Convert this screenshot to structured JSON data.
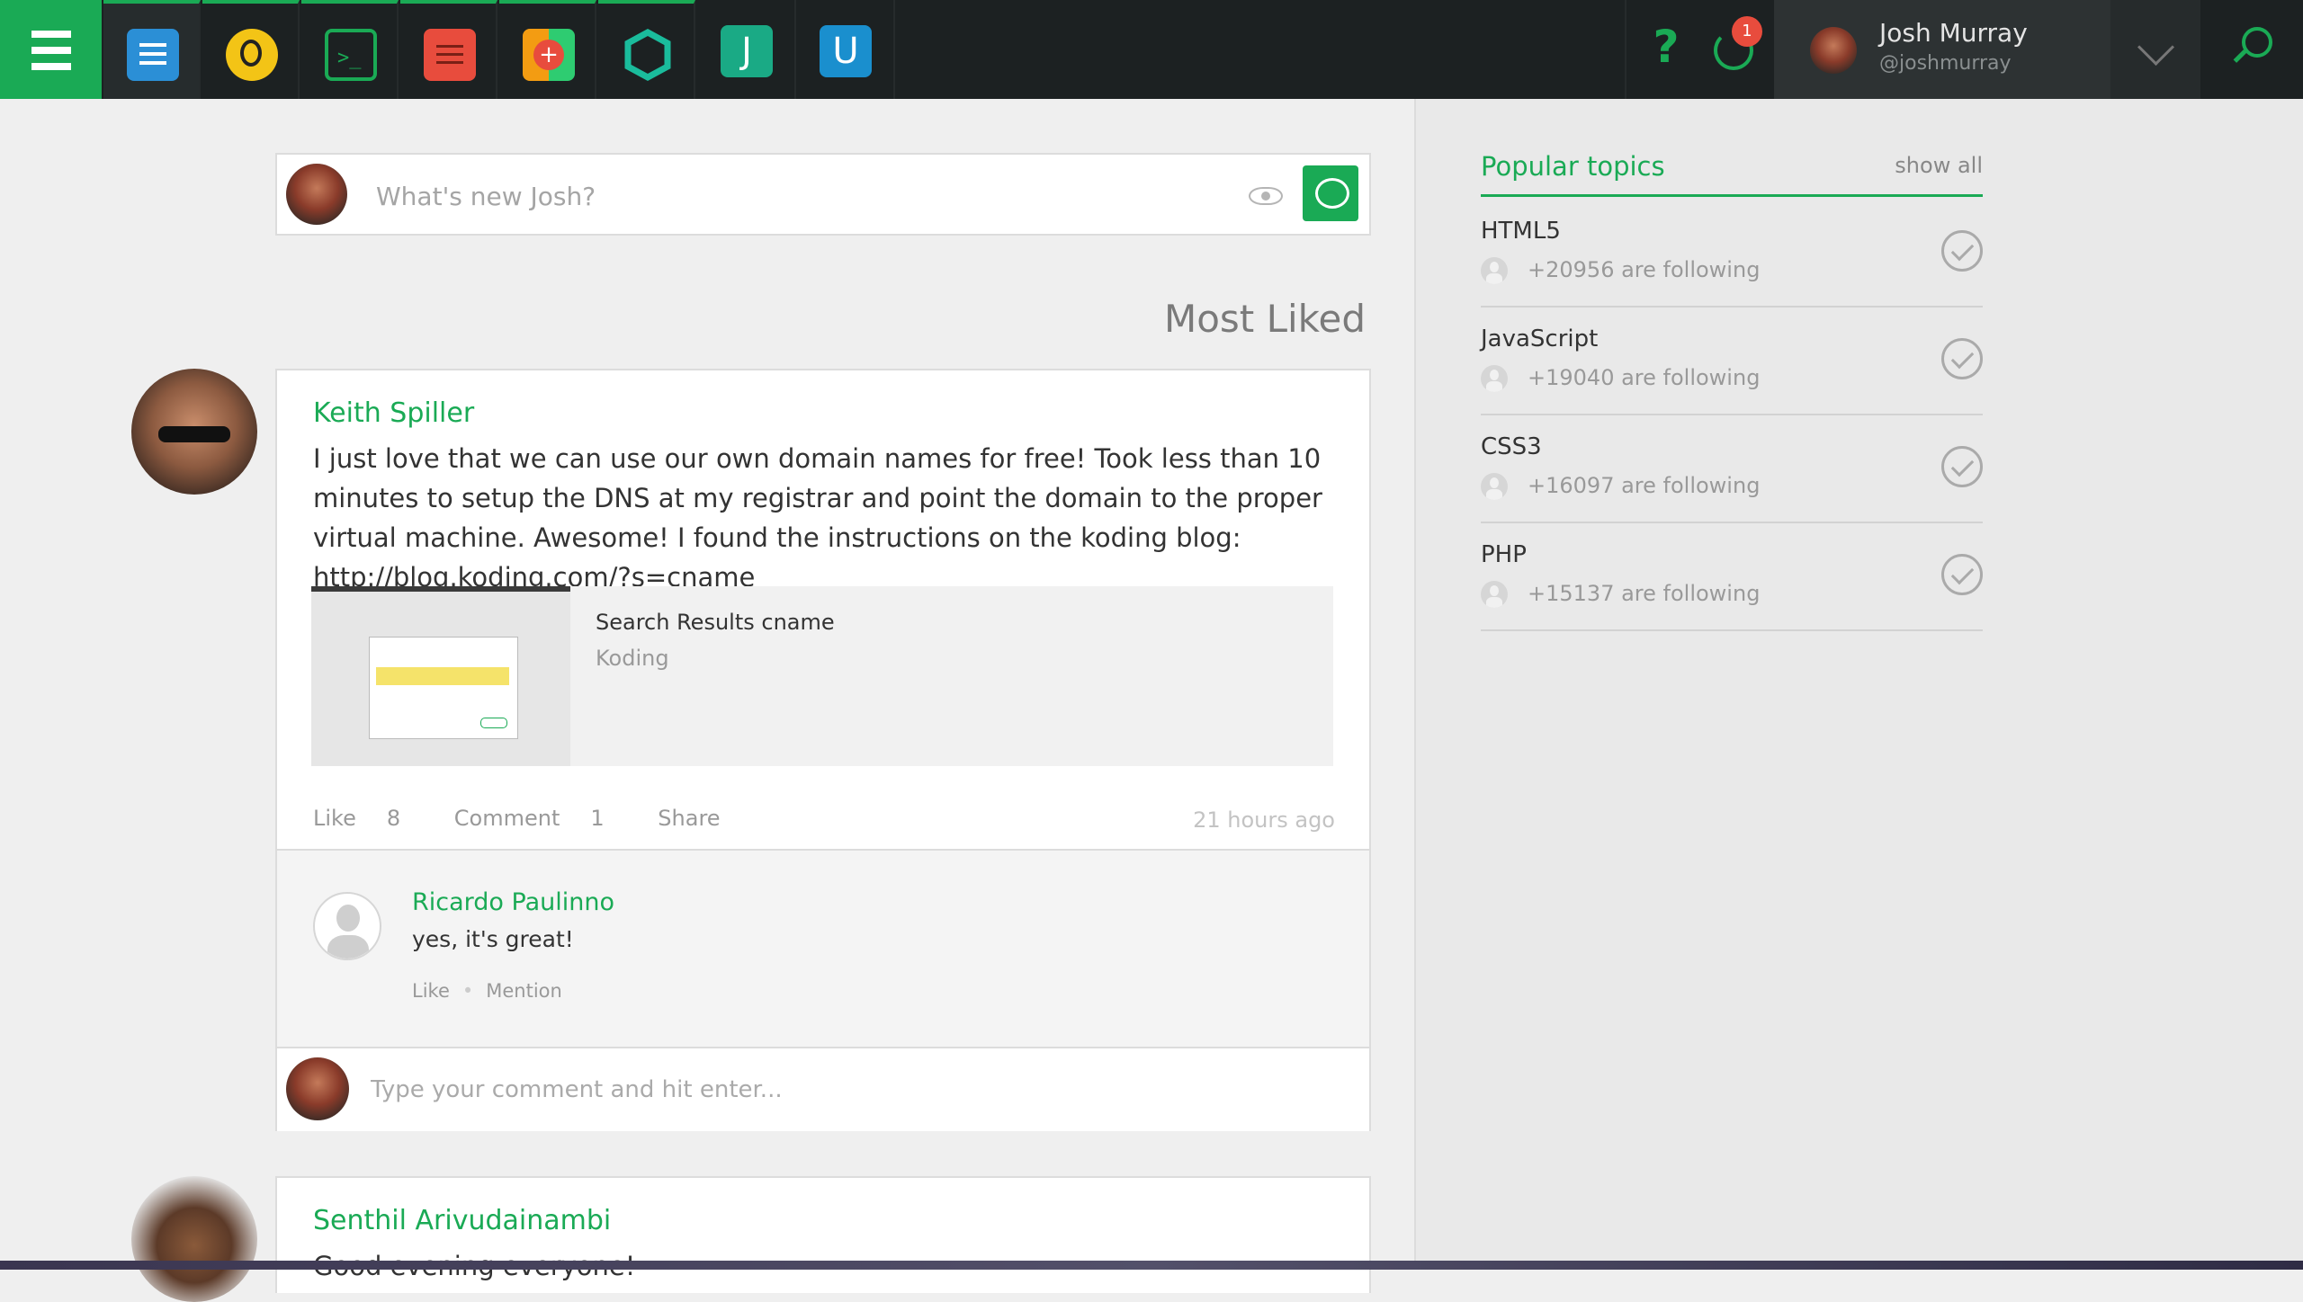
{
  "topbar": {
    "apps": [
      {
        "name": "activity",
        "color": "#2b8fd6"
      },
      {
        "name": "teamwork",
        "color": "#f3c416"
      },
      {
        "name": "terminal",
        "color": "#1aaa55"
      },
      {
        "name": "notes",
        "color": "#e84c3d"
      },
      {
        "name": "collab",
        "color": "#f39c12"
      },
      {
        "name": "hexagon",
        "color": "#1abc9c"
      },
      {
        "name": "J",
        "letter": "J",
        "color": "#1aaa85"
      },
      {
        "name": "U",
        "letter": "U",
        "color": "#1a8fce"
      }
    ],
    "help_label": "?",
    "notification_count": "1",
    "user": {
      "name": "Josh Murray",
      "handle": "@joshmurray"
    }
  },
  "composer": {
    "placeholder": "What's new Josh?"
  },
  "feed": {
    "title": "Most Liked",
    "posts": [
      {
        "author": "Keith Spiller",
        "body_before_link": "I just love that we can use our own domain names for free! Took less than 10 minutes to setup the DNS at my registrar and point the domain to the proper virtual machine. Awesome! I found the instructions on the koding blog: ",
        "link": "http://blog.koding.com/?s=cname",
        "embed": {
          "title": "Search Results cname",
          "site": "Koding"
        },
        "actions": {
          "like_label": "Like",
          "like_count": "8",
          "comment_label": "Comment",
          "comment_count": "1",
          "share_label": "Share"
        },
        "time": "21 hours ago",
        "comments": [
          {
            "author": "Ricardo Paulinno",
            "text": "yes, it's great!",
            "like_label": "Like",
            "mention_label": "Mention"
          }
        ],
        "comment_placeholder": "Type your comment and hit enter..."
      },
      {
        "author": "Senthil Arivudainambi",
        "body": "Good evening everyone!"
      }
    ]
  },
  "sidebar": {
    "popular_topics": {
      "title": "Popular topics",
      "show_all": "show all",
      "topics": [
        {
          "name": "HTML5",
          "following": "+20956 are following"
        },
        {
          "name": "JavaScript",
          "following": "+19040 are following"
        },
        {
          "name": "CSS3",
          "following": "+16097 are following"
        },
        {
          "name": "PHP",
          "following": "+15137 are following"
        }
      ]
    }
  },
  "colors": {
    "accent": "#1aaa55",
    "topbar": "#1c2122",
    "badge": "#e84c3d"
  }
}
